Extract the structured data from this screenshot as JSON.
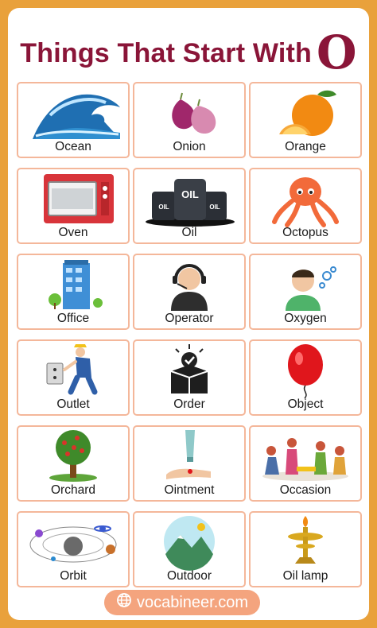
{
  "title": {
    "text": "Things That Start With",
    "letter": "O"
  },
  "tiles": [
    {
      "label": "Ocean"
    },
    {
      "label": "Onion"
    },
    {
      "label": "Orange"
    },
    {
      "label": "Oven"
    },
    {
      "label": "Oil"
    },
    {
      "label": "Octopus"
    },
    {
      "label": "Office"
    },
    {
      "label": "Operator"
    },
    {
      "label": "Oxygen"
    },
    {
      "label": "Outlet"
    },
    {
      "label": "Order"
    },
    {
      "label": "Object"
    },
    {
      "label": "Orchard"
    },
    {
      "label": "Ointment"
    },
    {
      "label": "Occasion"
    },
    {
      "label": "Orbit"
    },
    {
      "label": "Outdoor"
    },
    {
      "label": "Oil lamp"
    }
  ],
  "oil_text": {
    "main": "OIL",
    "small": "OIL"
  },
  "footer": {
    "text": "vocabineer.com",
    "icon": "globe-icon"
  },
  "colors": {
    "background": "#e9a13b",
    "title": "#8a1538",
    "tile_border": "#f4b79a",
    "footer": "#f4a47e"
  }
}
